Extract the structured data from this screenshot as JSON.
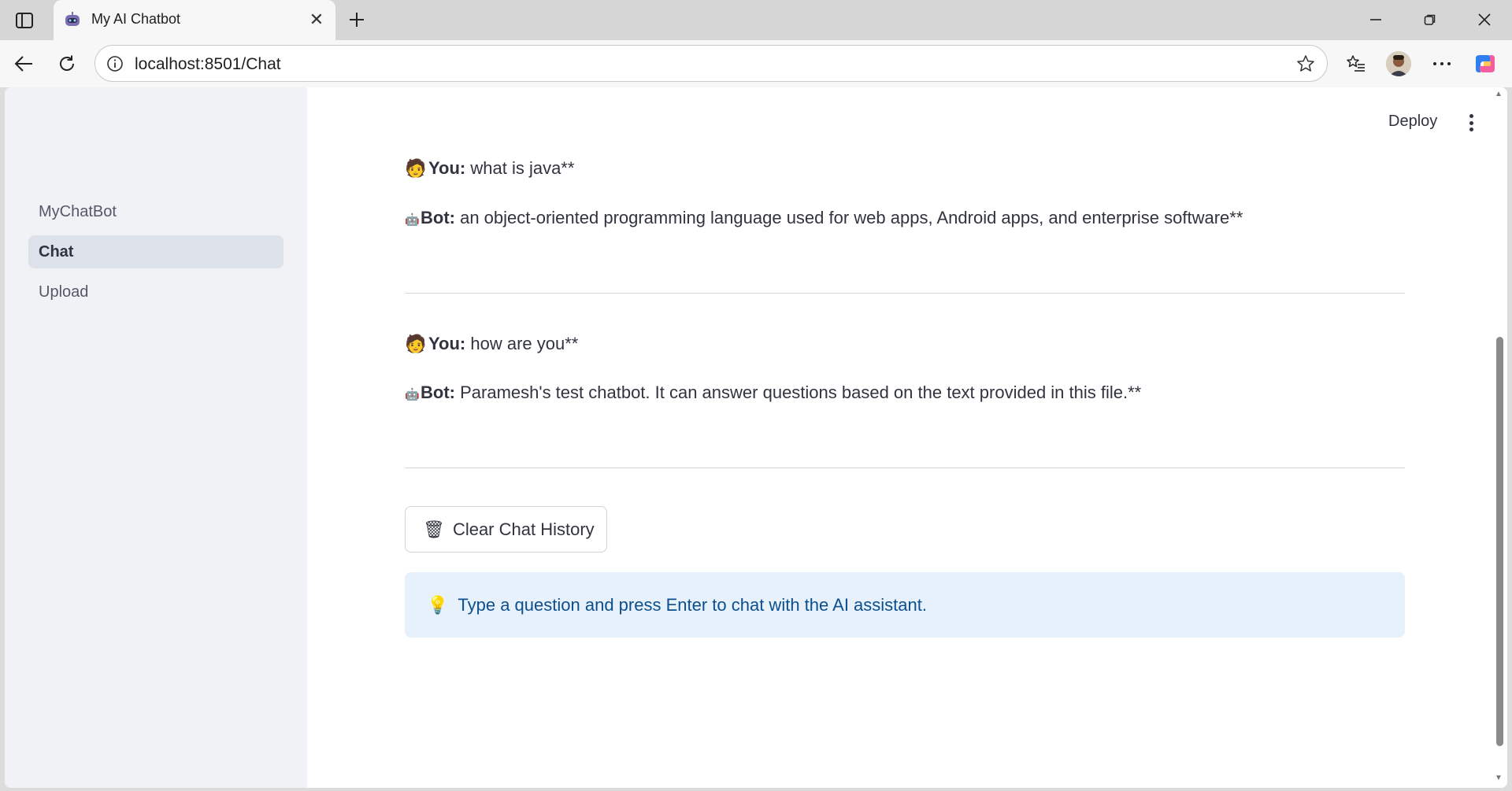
{
  "browser": {
    "tab_title": "My AI Chatbot",
    "url": "localhost:8501/Chat",
    "tab_close_glyph": "✕"
  },
  "sidebar": {
    "items": [
      {
        "label": "MyChatBot",
        "active": false
      },
      {
        "label": "Chat",
        "active": true
      },
      {
        "label": "Upload",
        "active": false
      }
    ]
  },
  "header": {
    "deploy_label": "Deploy"
  },
  "chat": {
    "messages": [
      {
        "you_emoji": "🧑",
        "you_label": "You:",
        "you_text": " what is java**",
        "bot_emoji": "🤖",
        "bot_label": "Bot:",
        "bot_text": " an object-oriented programming language used for web apps, Android apps, and enterprise software**"
      },
      {
        "you_emoji": "🧑",
        "you_label": "You:",
        "you_text": " how are you**",
        "bot_emoji": "🤖",
        "bot_label": "Bot:",
        "bot_text": " Paramesh's test chatbot. It can answer questions based on the text provided in this file.**"
      }
    ]
  },
  "actions": {
    "clear_icon": "🗑",
    "clear_label": "Clear Chat History"
  },
  "info": {
    "icon": "💡",
    "text": "Type a question and press Enter to chat with the AI assistant."
  },
  "colors": {
    "sidebar_bg": "#f0f2f6",
    "info_bg": "#e6f1fc",
    "info_text": "#0d4f8c"
  }
}
